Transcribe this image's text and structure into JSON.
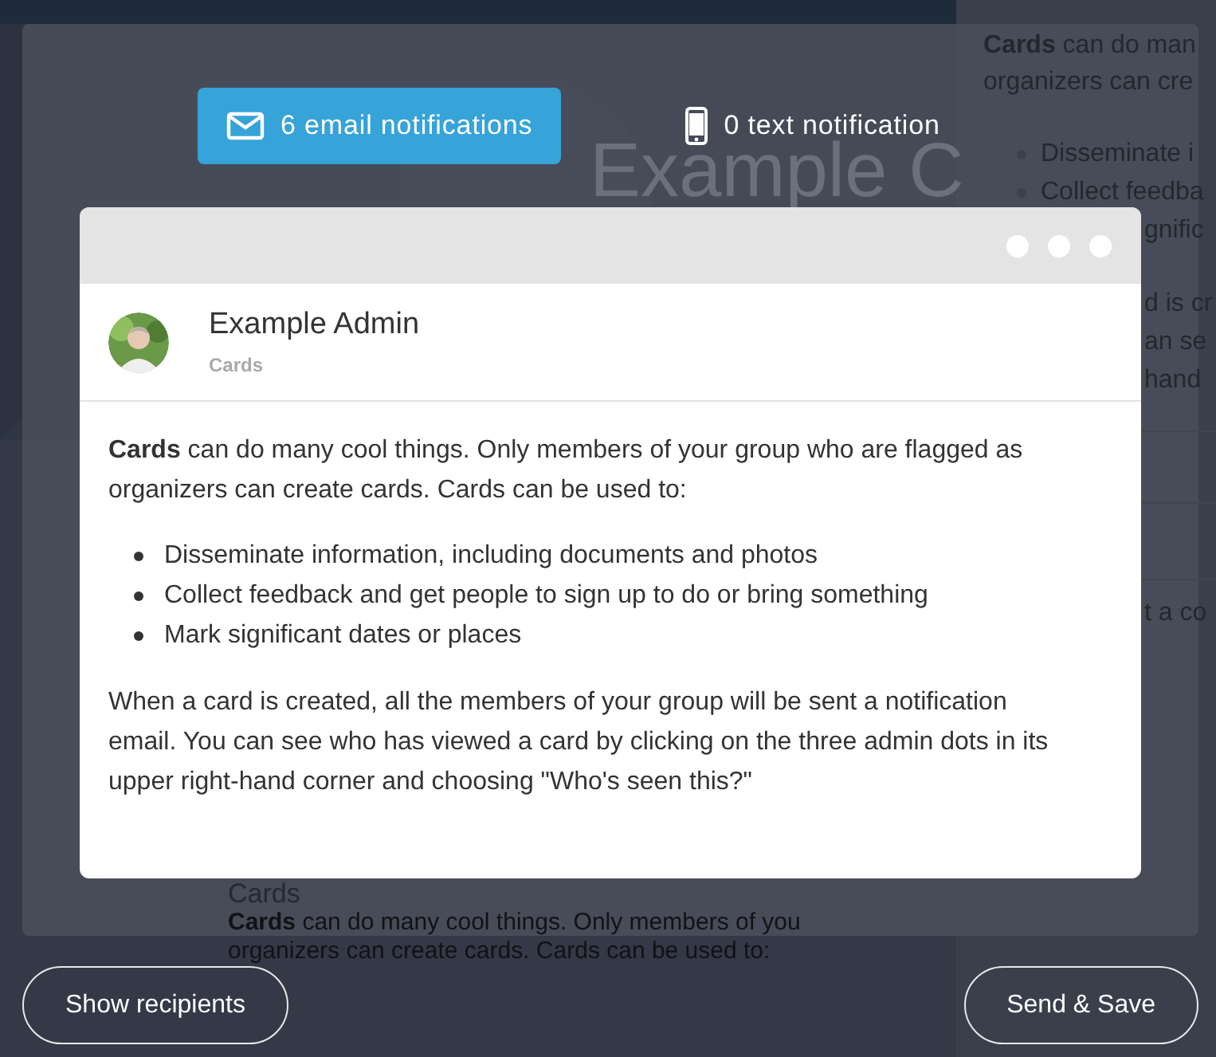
{
  "background": {
    "title": "Example C",
    "side_lines": [
      "**Cards** can do man",
      "organizers can cre"
    ],
    "side_bullets": [
      "Disseminate i",
      "Collect feedba",
      "gnific"
    ],
    "side_para": [
      "d is cr",
      "an se",
      "hand"
    ],
    "side_field": "t a co",
    "lower_heading": "Cards",
    "lower_lines": [
      "**Cards** can do many cool things. Only members of you",
      "organizers can create cards. Cards can be used to:"
    ]
  },
  "tabs": [
    {
      "label": "6 email notifications",
      "kind": "email",
      "selected": true
    },
    {
      "label": "0 text notification",
      "kind": "text",
      "selected": false
    }
  ],
  "card": {
    "author": "Example Admin",
    "category": "Cards",
    "intro": "**Cards** can do many cool things. Only members of your group who are flagged as organizers can create cards. Cards can be used to:",
    "bullets": [
      "Disseminate information, including documents and photos",
      "Collect feedback and get people to sign up to do or bring something",
      "Mark significant dates or places"
    ],
    "outro": "When a card is created, all the members of your group will be sent a notification email. You can see who has viewed a card by clicking on the three admin dots in its upper right-hand corner and choosing \"Who's seen this?\""
  },
  "buttons": [
    "Show recipients",
    "Send & Save"
  ]
}
